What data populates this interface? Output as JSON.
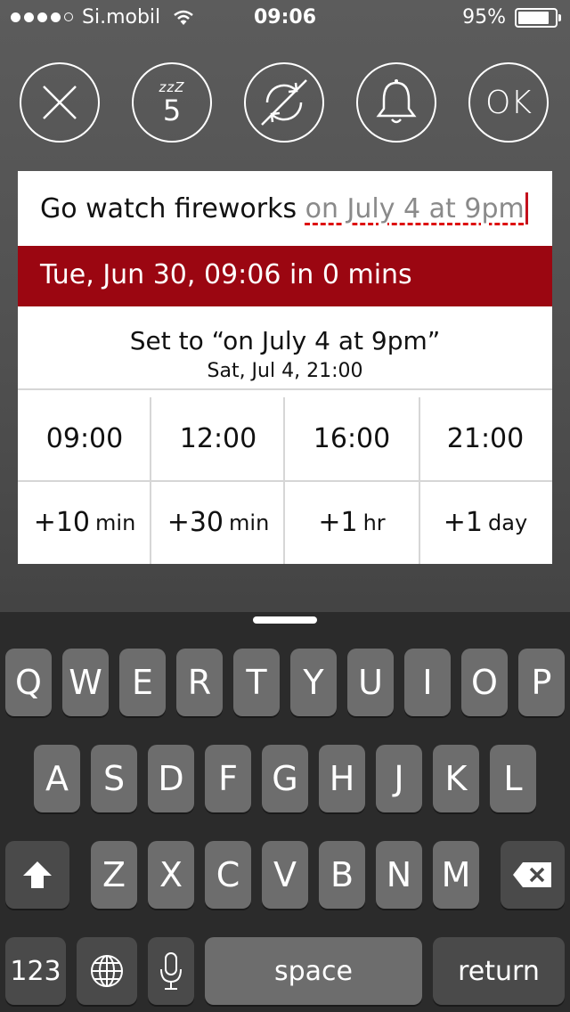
{
  "status": {
    "carrier": "Si.mobil",
    "time": "09:06",
    "battery_percent": "95%",
    "battery_level": 0.95,
    "signal_bars": 4
  },
  "actions": {
    "snooze_count": "5",
    "snooze_z": "zzZ",
    "ok_label": "OK"
  },
  "reminder": {
    "title_text": "Go watch fireworks ",
    "parsed_text": "on July 4 at 9pm",
    "current_due": "Tue, Jun 30, 09:06 in 0 mins",
    "suggestion_title": "Set to “on July 4 at 9pm”",
    "suggestion_sub": "Sat, Jul 4, 21:00"
  },
  "time_presets": [
    "09:00",
    "12:00",
    "16:00",
    "21:00"
  ],
  "offset_presets": [
    {
      "value": "+10",
      "unit": "min"
    },
    {
      "value": "+30",
      "unit": "min"
    },
    {
      "value": "+1",
      "unit": "hr"
    },
    {
      "value": "+1",
      "unit": "day"
    }
  ],
  "keyboard": {
    "row1": [
      "Q",
      "W",
      "E",
      "R",
      "T",
      "Y",
      "U",
      "I",
      "O",
      "P"
    ],
    "row2": [
      "A",
      "S",
      "D",
      "F",
      "G",
      "H",
      "J",
      "K",
      "L"
    ],
    "row3": [
      "Z",
      "X",
      "C",
      "V",
      "B",
      "N",
      "M"
    ],
    "numbers_label": "123",
    "space_label": "space",
    "return_label": "return"
  }
}
